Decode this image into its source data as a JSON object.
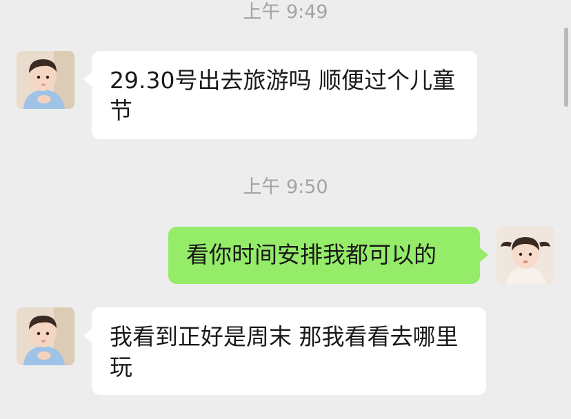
{
  "chat": {
    "timestamps": [
      "上午 9:49",
      "上午 9:50"
    ],
    "messages": [
      {
        "sender": "contact",
        "text": "29.30号出去旅游吗 顺便过个儿童节"
      },
      {
        "sender": "self",
        "text": "看你时间安排我都可以的"
      },
      {
        "sender": "contact",
        "text": "我看到正好是周末 那我看看去哪里玩"
      }
    ]
  },
  "colors": {
    "background": "#ededed",
    "incoming_bubble": "#ffffff",
    "outgoing_bubble": "#95ec69",
    "timestamp": "#a3a3a3"
  }
}
